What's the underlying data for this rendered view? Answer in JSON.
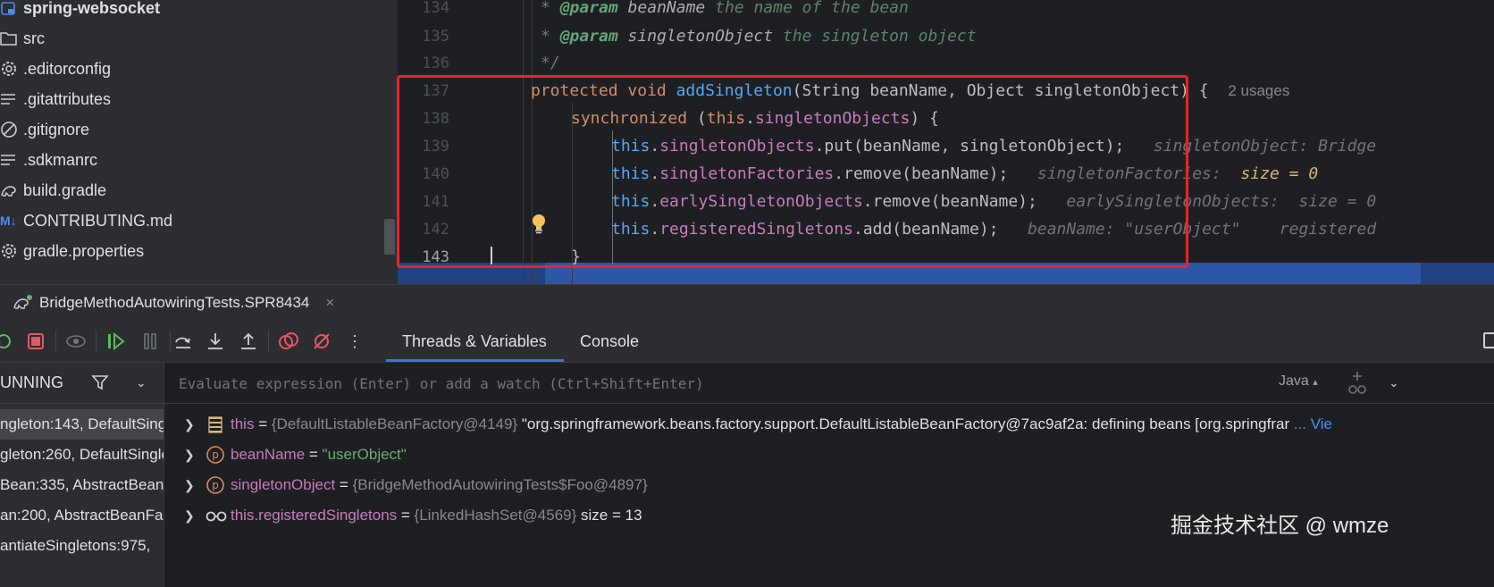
{
  "project_tree": {
    "root": "spring-websocket",
    "items": [
      {
        "label": "src",
        "icon": "folder-icon"
      },
      {
        "label": ".editorconfig",
        "icon": "gear-icon"
      },
      {
        "label": ".gitattributes",
        "icon": "text-file-icon"
      },
      {
        "label": ".gitignore",
        "icon": "ignore-file-icon"
      },
      {
        "label": ".sdkmanrc",
        "icon": "text-file-icon"
      },
      {
        "label": "build.gradle",
        "icon": "gradle-icon"
      },
      {
        "label": "CONTRIBUTING.md",
        "icon": "markdown-icon",
        "icon_text": "M↓"
      },
      {
        "label": "gradle.properties",
        "icon": "gear-icon"
      }
    ]
  },
  "editor": {
    "line_numbers": [
      "134",
      "135",
      "136",
      "137",
      "138",
      "139",
      "140",
      "141",
      "142",
      "143"
    ],
    "current_line": "143",
    "l134": {
      "star": "* ",
      "tag": "@param",
      "param": " beanName",
      "desc": " the name of the bean"
    },
    "l135": {
      "star": "* ",
      "tag": "@param",
      "param": " singletonObject",
      "desc": " the singleton object"
    },
    "l136": {
      "text": "*/"
    },
    "l137": {
      "kw1": "protected",
      "kw2": "void",
      "fn": "addSingleton",
      "rest": "(String beanName, Object singletonObject) {",
      "usages": "2 usages"
    },
    "l138": {
      "kw": "synchronized",
      "p1": " (",
      "this": "this",
      "dot": ".",
      "fld": "singletonObjects",
      "p2": ") {"
    },
    "l139": {
      "this": "this",
      "dot": ".",
      "fld": "singletonObjects",
      "call": ".put(beanName, singletonObject);",
      "hint": "singletonObject: Bridge"
    },
    "l140": {
      "this": "this",
      "dot": ".",
      "fld": "singletonFactories",
      "call": ".remove(beanName);",
      "hint": "singletonFactories:",
      "hint_val": "size = 0"
    },
    "l141": {
      "this": "this",
      "dot": ".",
      "fld": "earlySingletonObjects",
      "call": ".remove(beanName);",
      "hint": "earlySingletonObjects:  size = 0"
    },
    "l142": {
      "this": "this",
      "dot": ".",
      "fld": "registeredSingletons",
      "call": ".add(beanName);",
      "hint": "beanName: \"userObject\"    registered"
    },
    "l143": {
      "text": "}"
    }
  },
  "debug": {
    "tab_label": "BridgeMethodAutowiringTests.SPR8434",
    "close_glyph": "×",
    "subtabs": [
      "Threads & Variables",
      "Console"
    ],
    "active_subtab": "Threads & Variables",
    "frames_status": "UNNING",
    "frames": [
      "ngleton:143, DefaultSingl",
      "gleton:260, DefaultSingle",
      "Bean:335, AbstractBeanF",
      "an:200, AbstractBeanFac",
      "antiateSingletons:975,"
    ],
    "eval_placeholder": "Evaluate expression (Enter) or add a watch (Ctrl+Shift+Enter)",
    "language": "Java",
    "language_caret": "▴",
    "variables": [
      {
        "name": "this",
        "eq": " = ",
        "type": "{DefaultListableBeanFactory@4149}",
        "value": " \"org.springframework.beans.factory.support.DefaultListableBeanFactory@7ac9af2a: defining beans [org.springfrar",
        "link": " ... Vie",
        "icon": "field-list-icon"
      },
      {
        "name": "beanName",
        "eq": " = ",
        "str": "\"userObject\"",
        "icon": "parameter-icon",
        "icon_letter": "p"
      },
      {
        "name": "singletonObject",
        "eq": " = ",
        "type": "{BridgeMethodAutowiringTests$Foo@4897}",
        "icon": "parameter-icon",
        "icon_letter": "p"
      },
      {
        "name": "this.registeredSingletons",
        "eq": " = ",
        "type": "{LinkedHashSet@4569}",
        "value": "  size = 13",
        "icon": "watch-glasses-icon"
      }
    ]
  },
  "watermark": "掘金技术社区 @ wmze",
  "colors": {
    "highlight_box": "#e9242b",
    "current_line": "#214283",
    "accent": "#3574f0"
  }
}
